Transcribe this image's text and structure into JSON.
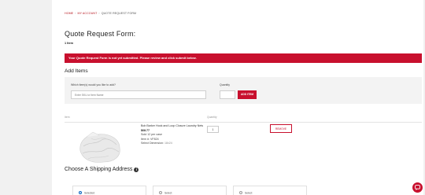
{
  "breadcrumb": {
    "home": "HOME",
    "account": "MY ACCOUNT",
    "current": "QUOTE REQUEST FORM",
    "separator": "›"
  },
  "header": {
    "title": "Quote Request Form:",
    "item_count": "1 Item"
  },
  "alert": {
    "message": "Your Quote Request Form is not yet submitted. Please review and click submit below."
  },
  "add_items": {
    "title": "Add Items",
    "item_label": "Which item(s) would you like to add?",
    "item_placeholder": "Enter SKU or Item Name",
    "quantity_label": "Quantity",
    "add_button": "ADD ITEM"
  },
  "table": {
    "col_item": "Item",
    "col_quantity": "Quantity"
  },
  "product": {
    "name": "Bob Barker Hook and Loop Closure Laundry Nets",
    "price": "$68.77",
    "sold": "Sold 12 per case",
    "item_no": "Item #: VF824",
    "dimension_label": "Select Dimension:",
    "dimension_value": "18x24",
    "quantity": "1",
    "remove_label": "REMOVE"
  },
  "shipping": {
    "title": "Choose A Shipping Address",
    "options": [
      {
        "label": "Selected",
        "selected": true
      },
      {
        "label": "Select",
        "selected": false
      },
      {
        "label": "Select",
        "selected": false
      }
    ]
  },
  "colors": {
    "accent": "#c8102e",
    "radio_selected": "#0a66c2"
  }
}
